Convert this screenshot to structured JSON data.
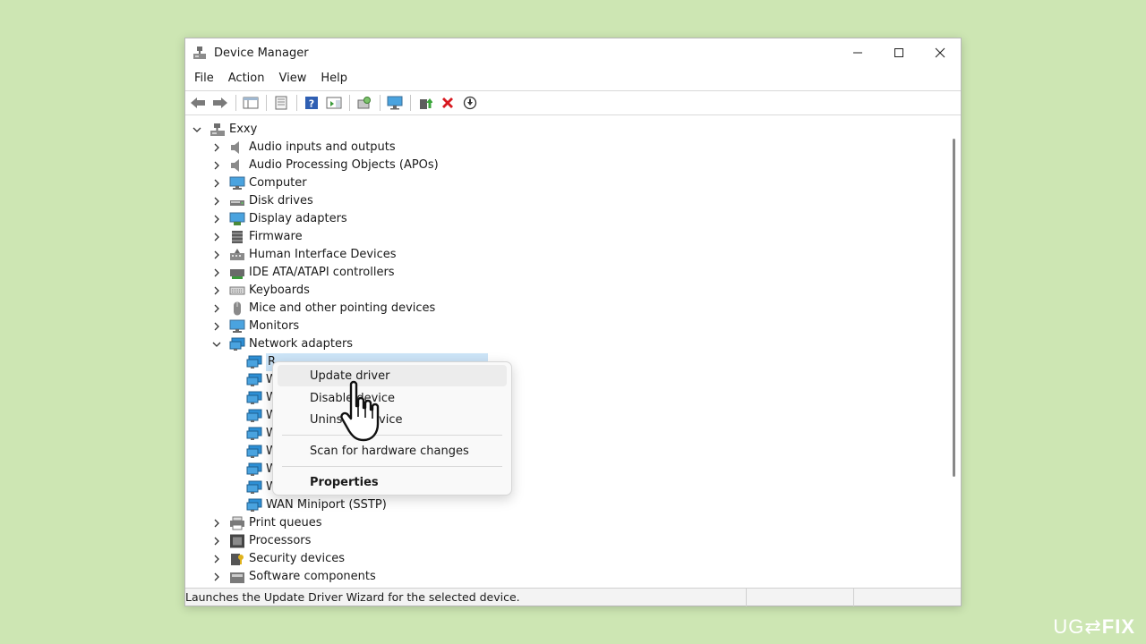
{
  "window": {
    "title": "Device Manager"
  },
  "menubar": [
    "File",
    "Action",
    "View",
    "Help"
  ],
  "tree": {
    "root": "Exxy",
    "categories_top": [
      {
        "label": "Audio inputs and outputs",
        "icon": "speaker-icon"
      },
      {
        "label": "Audio Processing Objects (APOs)",
        "icon": "speaker-icon"
      },
      {
        "label": "Computer",
        "icon": "monitor-icon"
      },
      {
        "label": "Disk drives",
        "icon": "disk-drive-icon"
      },
      {
        "label": "Display adapters",
        "icon": "display-adapter-icon"
      },
      {
        "label": "Firmware",
        "icon": "firmware-chip-icon"
      },
      {
        "label": "Human Interface Devices",
        "icon": "hid-icon"
      },
      {
        "label": "IDE ATA/ATAPI controllers",
        "icon": "ide-controller-icon"
      },
      {
        "label": "Keyboards",
        "icon": "keyboard-icon"
      },
      {
        "label": "Mice and other pointing devices",
        "icon": "mouse-icon"
      },
      {
        "label": "Monitors",
        "icon": "monitor-icon"
      },
      {
        "label": "Network adapters",
        "icon": "network-adapter-icon"
      }
    ],
    "network_children": [
      "R",
      "W",
      "W",
      "W",
      "W",
      "W",
      "W",
      "W",
      "WAN Miniport (SSTP)"
    ],
    "categories_bottom": [
      {
        "label": "Print queues",
        "icon": "printer-icon"
      },
      {
        "label": "Processors",
        "icon": "processor-icon"
      },
      {
        "label": "Security devices",
        "icon": "security-device-icon"
      },
      {
        "label": "Software components",
        "icon": "software-component-icon"
      }
    ]
  },
  "context_menu": {
    "update_driver": "Update driver",
    "disable_device": "Disable device",
    "uninstall_device": "Uninstall device",
    "scan": "Scan for hardware changes",
    "properties": "Properties"
  },
  "status": {
    "text": "Launches the Update Driver Wizard for the selected device."
  },
  "watermark": {
    "left": "UG",
    "arrows": "⇄",
    "right": "FIX"
  },
  "colors": {
    "background": "#cde6b3",
    "selection": "#cce4f7",
    "delete_red": "#d71920",
    "network_blue": "#2d8fd5"
  }
}
